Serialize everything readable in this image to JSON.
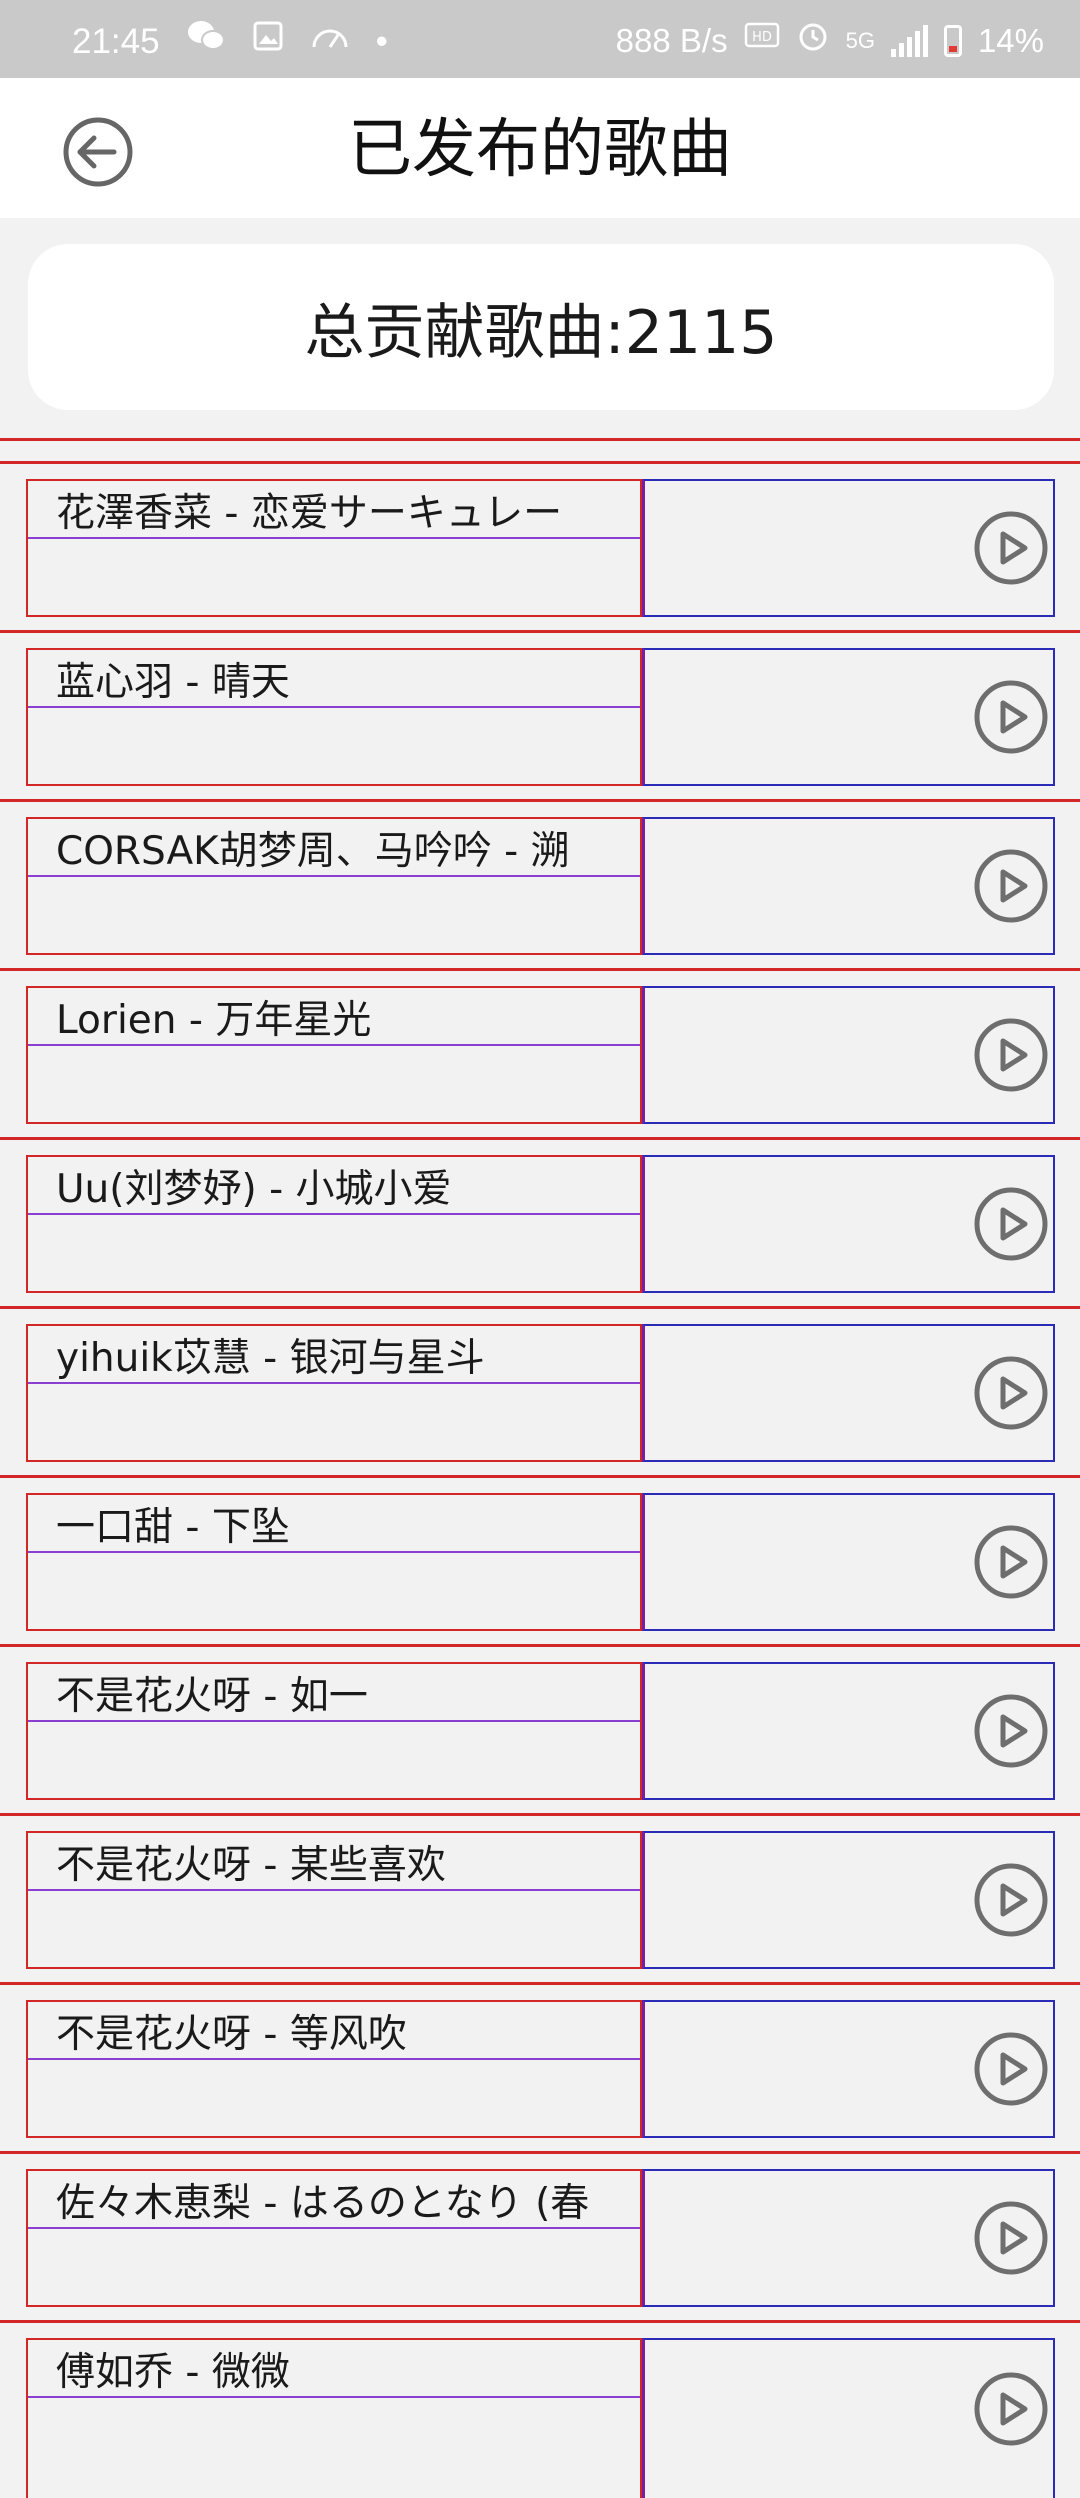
{
  "status_bar": {
    "time": "21:45",
    "dot": "•",
    "net_speed": "888 B/s",
    "network": "5G",
    "battery": "14%"
  },
  "header": {
    "title": "已发布的歌曲"
  },
  "summary": {
    "text": "总贡献歌曲:2115"
  },
  "songs": [
    {
      "title": "花澤香菜 - 恋爱サーキュレー"
    },
    {
      "title": "蓝心羽 - 晴天"
    },
    {
      "title": "CORSAK胡梦周、马吟吟 - 溯"
    },
    {
      "title": "Lorien - 万年星光"
    },
    {
      "title": "Uu(刘梦妤) - 小城小爱"
    },
    {
      "title": "yihuik苡慧 - 银河与星斗"
    },
    {
      "title": "一口甜 - 下坠"
    },
    {
      "title": "不是花火呀 - 如一"
    },
    {
      "title": "不是花火呀 - 某些喜欢"
    },
    {
      "title": "不是花火呀 - 等风吹"
    },
    {
      "title": "佐々木恵梨 - はるのとなり (春"
    },
    {
      "title": "傅如乔 - 微微"
    }
  ],
  "colors": {
    "row_divider": "#d32626",
    "cell_right_border": "#2b2bb8",
    "cell_separator": "#8a3fd1",
    "icon_gray": "#6e6e6e"
  }
}
